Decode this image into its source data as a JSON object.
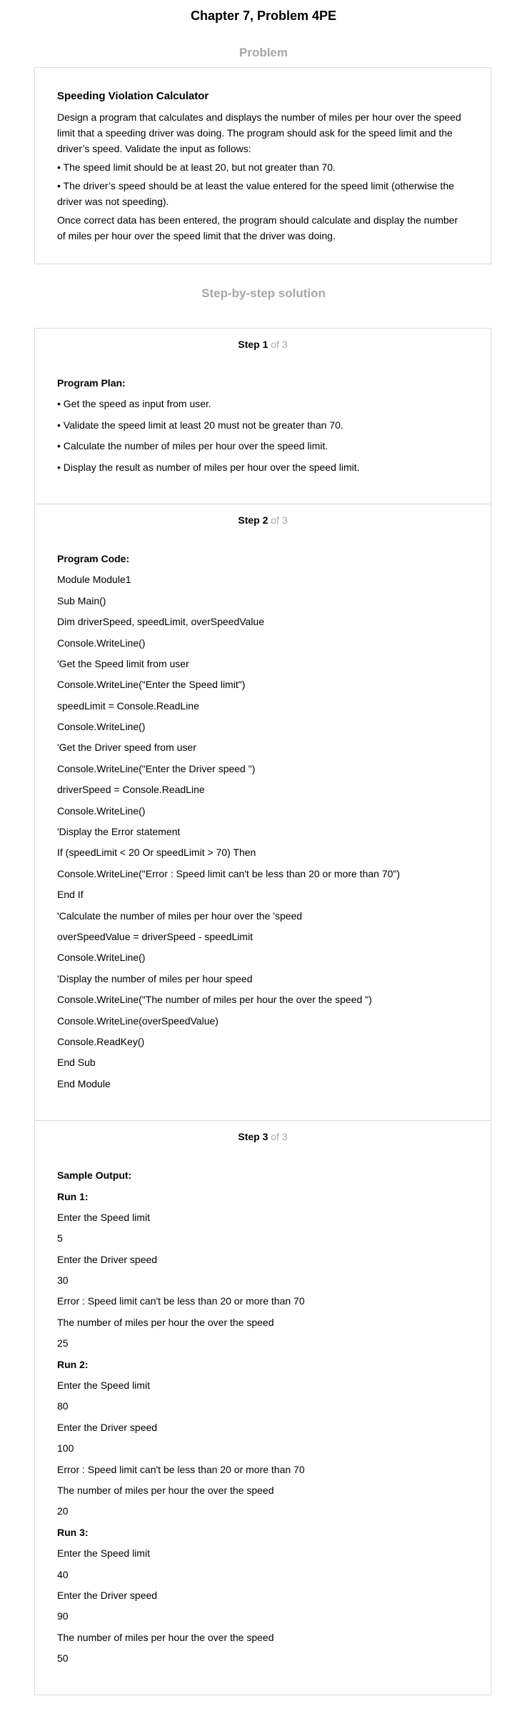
{
  "page_title": "Chapter 7, Problem 4PE",
  "problem": {
    "heading": "Problem",
    "title": "Speeding Violation Calculator",
    "paragraphs": [
      "Design a program that calculates and displays the number of miles per hour over the speed limit that a speeding driver was doing. The program should ask for the speed limit and the driver’s speed. Validate the input as follows:",
      "• The speed limit should be at least 20, but not greater than 70.",
      "• The driver’s speed should be at least the value entered for the speed limit (otherwise the driver was not speeding).",
      "Once correct data has been entered, the program should calculate and display the number of miles per hour over the speed limit that the driver was doing."
    ]
  },
  "solution": {
    "heading": "Step-by-step solution",
    "steps": [
      {
        "label": "Step 1",
        "of": "of 3",
        "lines": [
          {
            "text": "Program Plan:",
            "bold": true
          },
          {
            "text": "• Get the speed as input from user."
          },
          {
            "text": "• Validate the speed limit at least 20 must not be greater than 70."
          },
          {
            "text": "• Calculate the number of miles per hour over the speed limit."
          },
          {
            "text": "• Display the result as number of miles per hour over the speed limit."
          }
        ]
      },
      {
        "label": "Step 2",
        "of": "of 3",
        "lines": [
          {
            "text": "Program Code:",
            "bold": true
          },
          {
            "text": "Module Module1"
          },
          {
            "text": "Sub Main()"
          },
          {
            "text": "Dim driverSpeed, speedLimit, overSpeedValue"
          },
          {
            "text": "Console.WriteLine()"
          },
          {
            "text": "'Get the Speed limit from user"
          },
          {
            "text": "Console.WriteLine(\"Enter the Speed limit\")"
          },
          {
            "text": "speedLimit = Console.ReadLine"
          },
          {
            "text": "Console.WriteLine()"
          },
          {
            "text": "'Get the Driver speed from user"
          },
          {
            "text": "Console.WriteLine(\"Enter the Driver speed \")"
          },
          {
            "text": "driverSpeed = Console.ReadLine"
          },
          {
            "text": "Console.WriteLine()"
          },
          {
            "text": "'Display the Error statement"
          },
          {
            "text": "If (speedLimit < 20 Or speedLimit > 70) Then"
          },
          {
            "text": "Console.WriteLine(\"Error : Speed limit can't be less than 20 or more than 70\")"
          },
          {
            "text": "End If"
          },
          {
            "text": "'Calculate the number of miles per hour over the 'speed"
          },
          {
            "text": "overSpeedValue = driverSpeed - speedLimit"
          },
          {
            "text": "Console.WriteLine()"
          },
          {
            "text": "'Display the number of miles per hour speed"
          },
          {
            "text": "Console.WriteLine(\"The number of miles per hour the over the speed \")"
          },
          {
            "text": "Console.WriteLine(overSpeedValue)"
          },
          {
            "text": "Console.ReadKey()"
          },
          {
            "text": "End Sub"
          },
          {
            "text": "End Module"
          }
        ]
      },
      {
        "label": "Step 3",
        "of": "of 3",
        "lines": [
          {
            "text": "Sample Output:",
            "bold": true
          },
          {
            "text": "Run 1:",
            "bold": true
          },
          {
            "text": "Enter the Speed limit"
          },
          {
            "text": "5"
          },
          {
            "text": "Enter the Driver speed"
          },
          {
            "text": "30"
          },
          {
            "text": "Error : Speed limit can't be less than 20 or more than 70"
          },
          {
            "text": "The number of miles per hour the over the speed"
          },
          {
            "text": "25"
          },
          {
            "text": "Run 2:",
            "bold": true
          },
          {
            "text": "Enter the Speed limit"
          },
          {
            "text": "80"
          },
          {
            "text": "Enter the Driver speed"
          },
          {
            "text": "100"
          },
          {
            "text": "Error : Speed limit can't be less than 20 or more than 70"
          },
          {
            "text": "The number of miles per hour the over the speed"
          },
          {
            "text": "20"
          },
          {
            "text": "Run 3:",
            "bold": true
          },
          {
            "text": "Enter the Speed limit"
          },
          {
            "text": "40"
          },
          {
            "text": "Enter the Driver speed"
          },
          {
            "text": "90"
          },
          {
            "text": "The number of miles per hour the over the speed"
          },
          {
            "text": "50"
          }
        ]
      }
    ]
  }
}
